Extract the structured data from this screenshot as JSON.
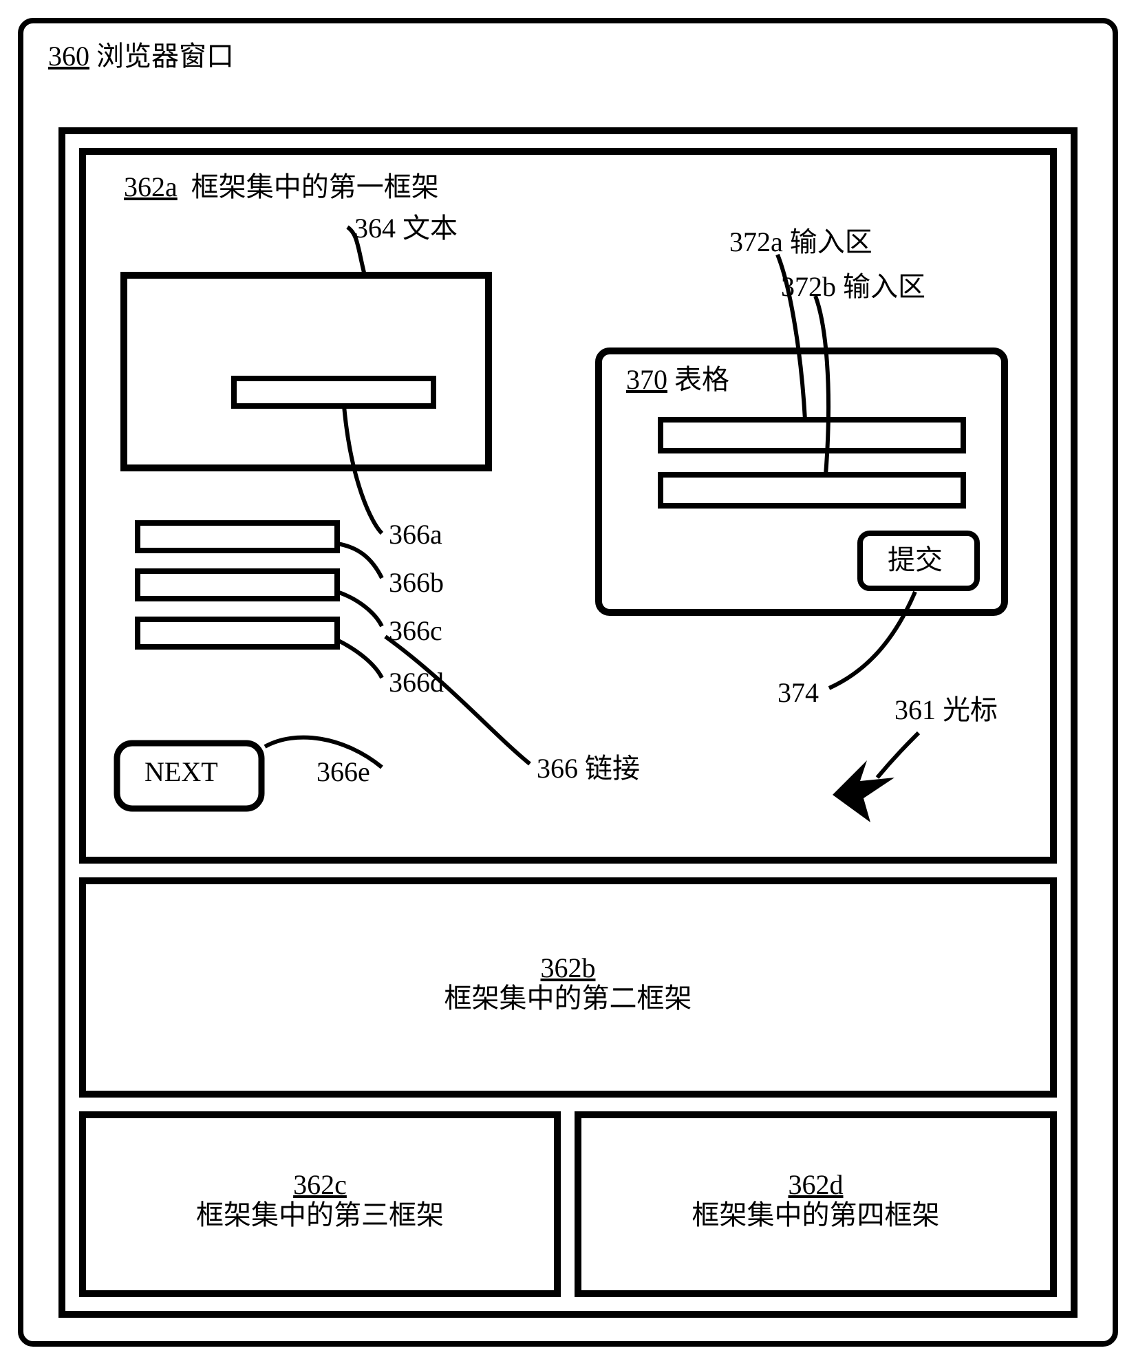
{
  "header": {
    "num": "360",
    "label": "浏览器窗口"
  },
  "frame1": {
    "num": "362a",
    "label": "框架集中的第一框架"
  },
  "text_box": {
    "num": "364",
    "label": "文本"
  },
  "links": {
    "a": "366a",
    "b": "366b",
    "c": "366c",
    "d": "366d",
    "e": "366e",
    "group_num": "366",
    "group_label": "链接"
  },
  "next": "NEXT",
  "form": {
    "num": "370",
    "label": "表格"
  },
  "input_a": {
    "num": "372a",
    "label": "输入区"
  },
  "input_b": {
    "num": "372b",
    "label": "输入区"
  },
  "submit": "提交",
  "submit_num": "374",
  "cursor": {
    "num": "361",
    "label": "光标"
  },
  "frame2": {
    "num": "362b",
    "label": "框架集中的第二框架"
  },
  "frame3": {
    "num": "362c",
    "label": "框架集中的第三框架"
  },
  "frame4": {
    "num": "362d",
    "label": "框架集中的第四框架"
  }
}
